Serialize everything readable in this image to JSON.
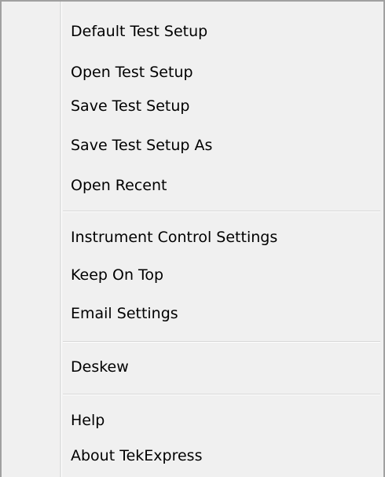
{
  "menu": {
    "items": [
      {
        "label": "Default Test Setup"
      },
      {
        "label": "Open Test Setup"
      },
      {
        "label": "Save Test Setup"
      },
      {
        "label": "Save Test Setup As"
      },
      {
        "label": "Open Recent"
      },
      {
        "label": "Instrument Control Settings"
      },
      {
        "label": "Keep On Top"
      },
      {
        "label": "Email Settings"
      },
      {
        "label": "Deskew"
      },
      {
        "label": "Help"
      },
      {
        "label": "About TekExpress"
      }
    ]
  }
}
